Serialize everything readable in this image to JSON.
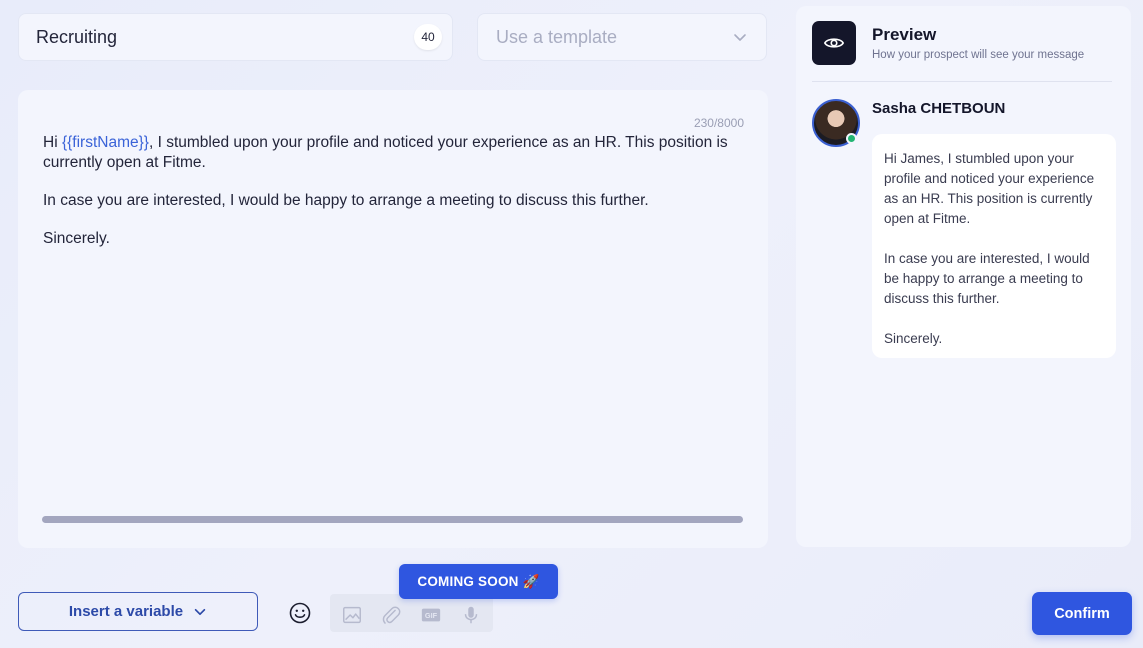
{
  "sequence_name": {
    "value": "Recruiting",
    "count": "40"
  },
  "template_select": {
    "placeholder": "Use a template"
  },
  "editor": {
    "char_count": "230/8000",
    "line1_prefix": "Hi ",
    "line1_variable": "{{firstName}}",
    "line1_suffix": ", I stumbled upon your profile and noticed your experience as an HR. This position is currently open at Fitme.",
    "paragraph2": "In case you are interested, I would be happy to arrange a meeting to discuss this further.",
    "paragraph3": "Sincerely."
  },
  "preview": {
    "title": "Preview",
    "subtitle": "How your prospect will see your message",
    "sender_name": "Sasha CHETBOUN",
    "message_p1": "Hi James, I stumbled upon your profile and noticed your experience as an HR. This position is currently open at Fitme.",
    "message_p2": "In case you are interested, I would be happy to arrange a meeting to discuss this further.",
    "message_p3": "Sincerely."
  },
  "toolbar": {
    "insert_variable_label": "Insert a variable",
    "coming_soon_label": "COMING SOON 🚀",
    "confirm_label": "Confirm",
    "icons": [
      "smiley-icon",
      "image-icon",
      "paperclip-icon",
      "gif-icon",
      "microphone-icon"
    ]
  },
  "colors": {
    "accent": "#2f56e0",
    "variable": "#3a63d8",
    "online": "#22b573",
    "dark": "#14162a"
  }
}
